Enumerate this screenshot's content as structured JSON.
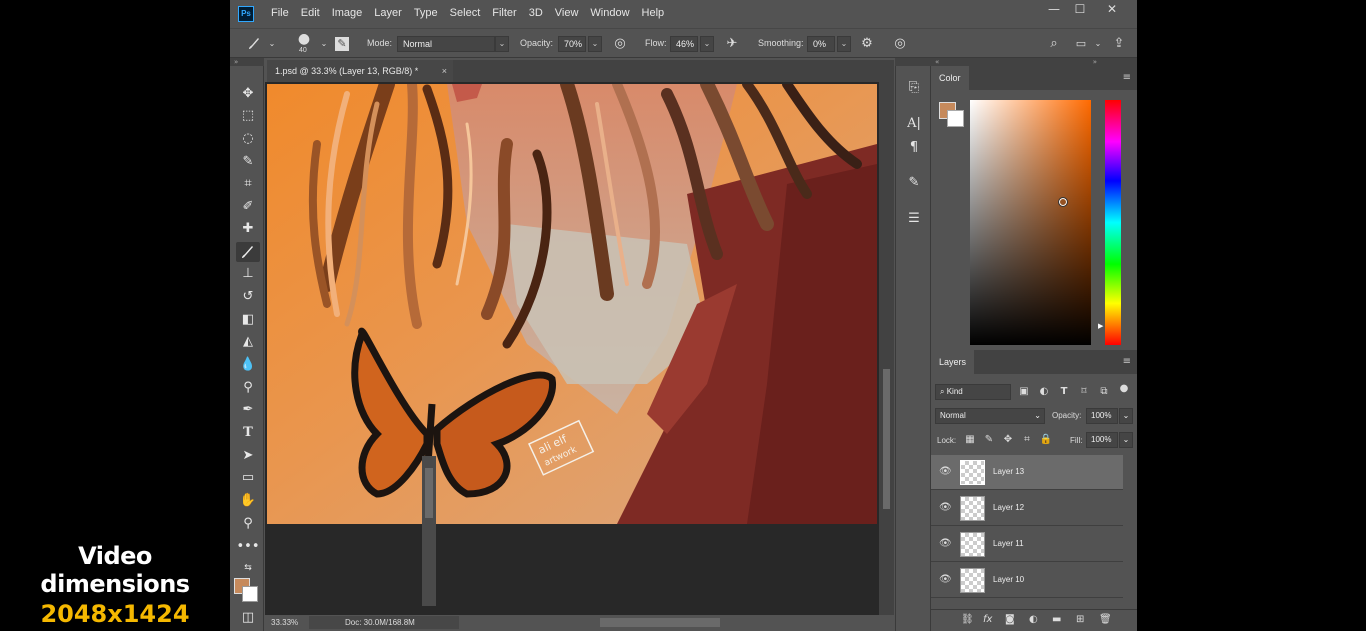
{
  "caption": {
    "line1": "Video dimensions",
    "line2": "2048x1424"
  },
  "app": {
    "logo": "Ps",
    "menu": [
      "File",
      "Edit",
      "Image",
      "Layer",
      "Type",
      "Select",
      "Filter",
      "3D",
      "View",
      "Window",
      "Help"
    ],
    "window_controls": {
      "minimize": "—",
      "maximize": "☐",
      "close": "✕"
    }
  },
  "options": {
    "brush_size": "40",
    "mode_label": "Mode:",
    "mode_value": "Normal",
    "opacity_label": "Opacity:",
    "opacity_value": "70%",
    "flow_label": "Flow:",
    "flow_value": "46%",
    "smoothing_label": "Smoothing:",
    "smoothing_value": "0%"
  },
  "document": {
    "tab_title": "1.psd @ 33.3% (Layer 13, RGB/8) *",
    "close": "×",
    "signature": "ali elf artwork"
  },
  "status": {
    "zoom": "33.33%",
    "doc": "Doc: 30.0M/168.8M"
  },
  "color_panel": {
    "tab": "Color",
    "fg_color": "#c68a5c",
    "bg_color": "#ffffff"
  },
  "layers_panel": {
    "tab": "Layers",
    "filter_label": "Kind",
    "blend_mode": "Normal",
    "opacity_label": "Opacity:",
    "opacity_value": "100%",
    "lock_label": "Lock:",
    "fill_label": "Fill:",
    "fill_value": "100%",
    "layers": [
      {
        "name": "Layer 13",
        "selected": true
      },
      {
        "name": "Layer 12",
        "selected": false
      },
      {
        "name": "Layer 11",
        "selected": false
      },
      {
        "name": "Layer 10",
        "selected": false
      }
    ]
  },
  "colors": {
    "accent": "#31a8ff",
    "ui_bg": "#535353",
    "caption_yellow": "#f5b800"
  }
}
